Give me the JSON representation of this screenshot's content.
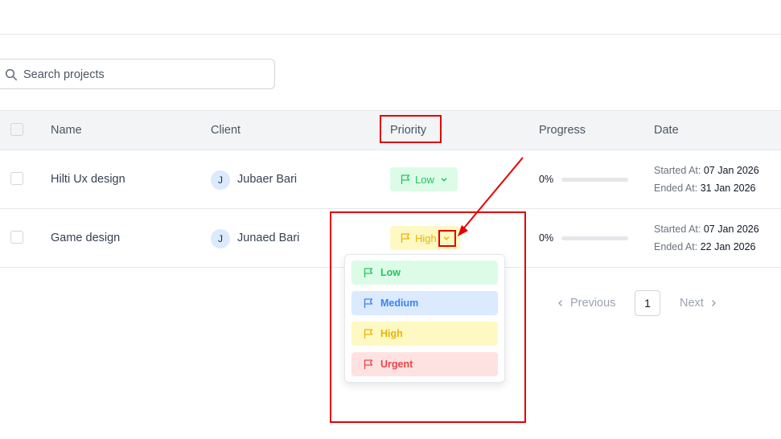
{
  "search": {
    "placeholder": "Search projects",
    "value": ""
  },
  "table": {
    "headers": [
      "Name",
      "Client",
      "Priority",
      "Progress",
      "Date"
    ],
    "rows": [
      {
        "name": "Hilti Ux design",
        "client_initial": "J",
        "client": "Jubaer Bari",
        "priority": "Low",
        "progress": "0%",
        "progress_value": 0,
        "started_label": "Started At:",
        "started": "07 Jan 2026",
        "ended_label": "Ended At:",
        "ended": "31 Jan 2026"
      },
      {
        "name": "Game design",
        "client_initial": "J",
        "client": "Junaed Bari",
        "priority": "High",
        "progress": "0%",
        "progress_value": 0,
        "started_label": "Started At:",
        "started": "07 Jan 2026",
        "ended_label": "Ended At:",
        "ended": "22 Jan 2026"
      }
    ]
  },
  "priority_dropdown": {
    "options": [
      "Low",
      "Medium",
      "High",
      "Urgent"
    ]
  },
  "pagination": {
    "previous": "Previous",
    "current_page": "1",
    "next": "Next"
  },
  "colors": {
    "low": "#22c55e",
    "medium": "#3b82f6",
    "high": "#eab308",
    "urgent": "#ef4444",
    "annotation": "#e60000"
  },
  "icons": [
    "search-icon",
    "flag-icon",
    "chevron-down-icon",
    "chevron-left-icon",
    "chevron-right-icon"
  ]
}
